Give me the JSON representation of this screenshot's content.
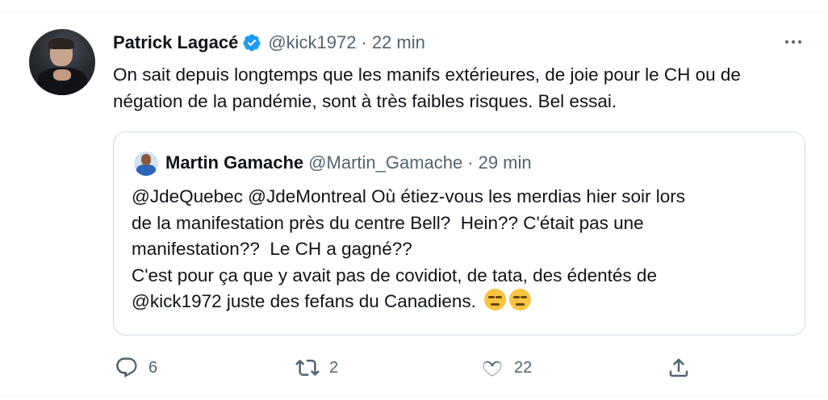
{
  "tweet": {
    "author_name": "Patrick Lagacé",
    "handle": "@kick1972",
    "separator": "·",
    "time": "22 min",
    "text": "On sait depuis longtemps que les manifs extérieures, de joie pour le CH ou de négation de la pandémie, sont à très faibles risques. Bel essai."
  },
  "quoted_tweet": {
    "author_name": "Martin Gamache",
    "handle": "@Martin_Gamache",
    "separator": "·",
    "time": "29 min",
    "lines": [
      "@JdeQuebec @JdeMontreal Où étiez-vous les merdias hier soir lors",
      "de la manifestation près du centre Bell?  Hein?? C'était pas une",
      "manifestation??  Le CH a gagné??",
      "C'est pour ça que y avait pas de covidiot, de tata, des édentés de",
      "@kick1972 juste des fefans du Canadiens. "
    ],
    "emojis": [
      "smirking-face",
      "unamused-face"
    ]
  },
  "actions": {
    "reply_count": "6",
    "retweet_count": "2",
    "like_count": "22"
  },
  "icons": {
    "verified": "verified-badge-icon",
    "more": "more-dots-icon",
    "reply": "reply-icon",
    "retweet": "retweet-icon",
    "like": "heart-icon",
    "share": "share-icon"
  },
  "colors": {
    "verified": "#1d9bf0",
    "secondary_text": "#536471",
    "border": "#cfd9de"
  }
}
